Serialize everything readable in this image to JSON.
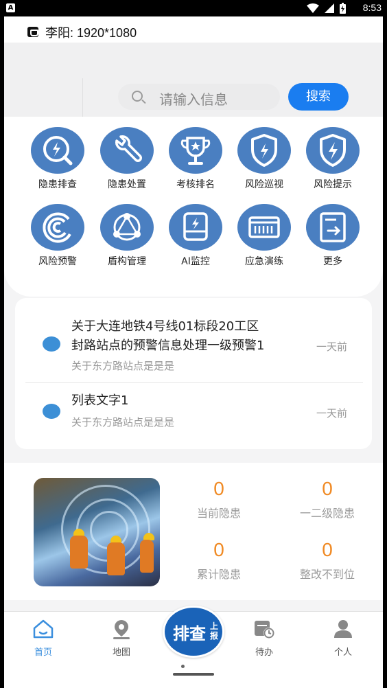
{
  "status_bar": {
    "app_badge": "A",
    "time": "8:53"
  },
  "title_bar": {
    "title": "李阳: 1920*1080"
  },
  "search": {
    "placeholder": "请输入信息",
    "button_label": "搜索"
  },
  "menu": [
    {
      "label": "隐患排查",
      "icon": "hazard-check-icon"
    },
    {
      "label": "隐患处置",
      "icon": "wrench-icon"
    },
    {
      "label": "考核排名",
      "icon": "trophy-icon"
    },
    {
      "label": "风险巡视",
      "icon": "shield-icon"
    },
    {
      "label": "风险提示",
      "icon": "shield-bolt-icon"
    },
    {
      "label": "风险预警",
      "icon": "warning-ring-icon"
    },
    {
      "label": "盾构管理",
      "icon": "network-icon"
    },
    {
      "label": "AI监控",
      "icon": "monitor-icon"
    },
    {
      "label": "应急演练",
      "icon": "drill-icon"
    },
    {
      "label": "更多",
      "icon": "more-icon"
    }
  ],
  "news": [
    {
      "title_line1": "关于大连地铁4号线01标段20工区",
      "title_line2": "封路站点的预警信息处理一级预警1",
      "subtitle": "关于东方路站点是是是",
      "time": "一天前"
    },
    {
      "title_line1": "列表文字1",
      "subtitle": "关于东方路站点是是是",
      "time": "一天前"
    }
  ],
  "stats": [
    {
      "value": "0",
      "label": "当前隐患"
    },
    {
      "value": "0",
      "label": "一二级隐患"
    },
    {
      "value": "0",
      "label": "累计隐患"
    },
    {
      "value": "0",
      "label": "整改不到位"
    }
  ],
  "tabbar": {
    "home": "首页",
    "map": "地图",
    "report_big": "排查",
    "report_small": "上报",
    "todo": "待办",
    "profile": "个人"
  },
  "colors": {
    "accent": "#1a7df0",
    "icon_circle": "#4a7fc1",
    "stat_value": "#f08a24",
    "tab_active": "#3b8fde"
  }
}
